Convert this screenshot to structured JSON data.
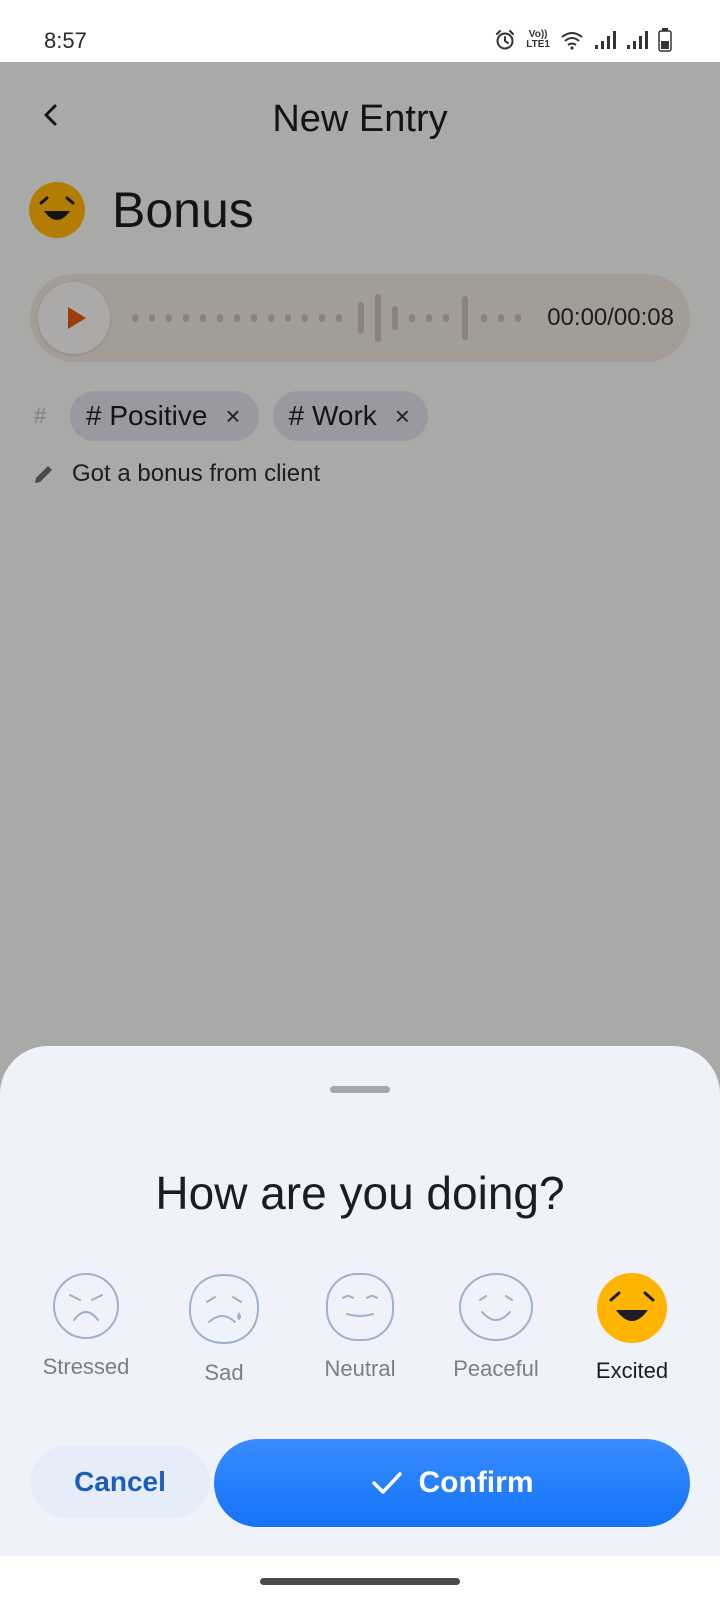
{
  "status_bar": {
    "time": "8:57",
    "icons": [
      "alarm-icon",
      "volte-icon",
      "wifi-icon",
      "signal-icon",
      "signal-icon",
      "battery-icon"
    ],
    "volte_line1": "Vo))",
    "volte_line2": "LTE1"
  },
  "header": {
    "title": "New Entry",
    "back_icon": "chevron-left-icon"
  },
  "entry": {
    "title": "Bonus",
    "mood_icon": "excited-face-icon",
    "audio": {
      "time": "00:00/00:08",
      "play_icon": "play-icon"
    },
    "tags_label": "#",
    "tags": [
      {
        "label": "# Positive",
        "close": "×"
      },
      {
        "label": "# Work",
        "close": "×"
      }
    ],
    "note": "Got a bonus from client",
    "note_icon": "pencil-icon"
  },
  "sheet": {
    "title": "How are you doing?",
    "moods": [
      {
        "label": "Stressed",
        "icon": "stressed-face-icon",
        "selected": false
      },
      {
        "label": "Sad",
        "icon": "sad-face-icon",
        "selected": false
      },
      {
        "label": "Neutral",
        "icon": "neutral-face-icon",
        "selected": false
      },
      {
        "label": "Peaceful",
        "icon": "peaceful-face-icon",
        "selected": false
      },
      {
        "label": "Excited",
        "icon": "excited-face-icon",
        "selected": true
      }
    ],
    "cancel_label": "Cancel",
    "confirm_label": "Confirm"
  },
  "colors": {
    "accent": "#1473f7",
    "excited_yellow": "#ffb400",
    "play_orange": "#e0570c",
    "mood_outline": "#9fb1cc"
  }
}
